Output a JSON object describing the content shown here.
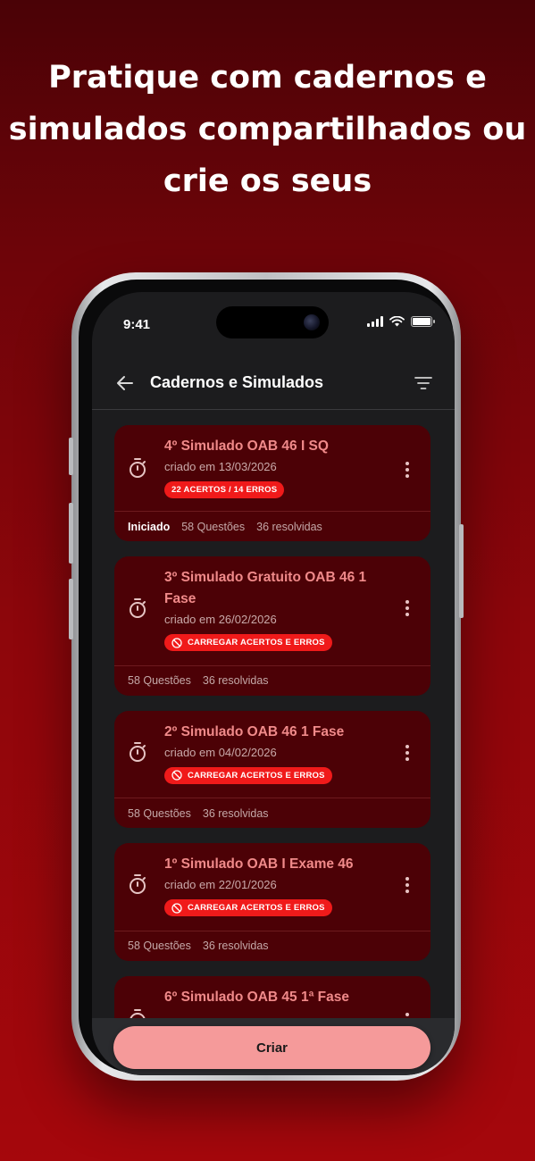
{
  "headline": {
    "line1": "Pratique com cadernos e",
    "line2": "simulados compartilhados ou",
    "line3": "crie os seus"
  },
  "status_bar": {
    "time": "9:41",
    "icons": [
      "signal-icon",
      "wifi-icon",
      "battery-icon"
    ]
  },
  "appbar": {
    "title": "Cadernos e Simulados",
    "back_icon": "arrow-left-icon",
    "filter_icon": "filter-icon"
  },
  "cards": [
    {
      "title": "4º Simulado OAB 46 I SQ",
      "date": "criado em 13/03/2026",
      "badge": "22 ACERTOS / 14 ERROS",
      "status": "Iniciado",
      "questions": "58 Questões",
      "resolved": "36 resolvidas"
    },
    {
      "title": "3º Simulado Gratuito OAB 46 1 Fase",
      "date": "criado em 26/02/2026",
      "badge": "CARREGAR ACERTOS E ERROS",
      "questions": "58 Questões",
      "resolved": "36 resolvidas"
    },
    {
      "title": "2º Simulado OAB 46 1 Fase",
      "date": "criado em 04/02/2026",
      "badge": "CARREGAR ACERTOS E ERROS",
      "questions": "58 Questões",
      "resolved": "36 resolvidas"
    },
    {
      "title": "1º Simulado OAB I Exame 46",
      "date": "criado em 22/01/2026",
      "badge": "CARREGAR ACERTOS E ERROS",
      "questions": "58 Questões",
      "resolved": "36 resolvidas"
    },
    {
      "title": "6º Simulado OAB 45 1ª Fase"
    }
  ],
  "create_button": {
    "label": "Criar"
  },
  "colors": {
    "background": "#8e060b",
    "card": "#4c0106",
    "card_title": "#f08a8a",
    "badge": "#f01a1a",
    "create_button": "#f59a9a"
  }
}
